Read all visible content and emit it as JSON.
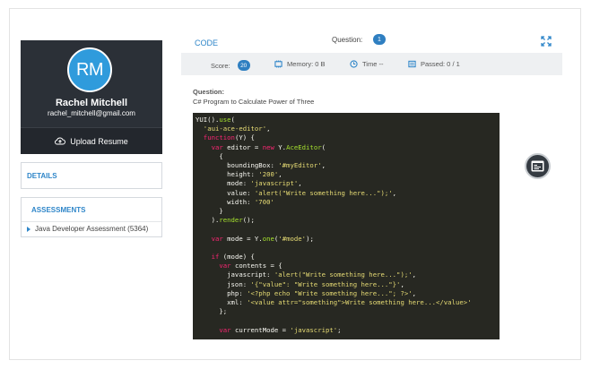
{
  "profile": {
    "initials": "RM",
    "name": "Rachel Mitchell",
    "email": "rachel_mitchell@gmail.com",
    "upload_label": "Upload Resume"
  },
  "nav": {
    "details_label": "DETAILS",
    "assessments_label": "ASSESSMENTS",
    "assessment_item": "Java Developer Assessment (5364)"
  },
  "header": {
    "code_label": "CODE",
    "question_label": "Question:",
    "question_number": "1"
  },
  "stats": {
    "score_label": "Score:",
    "score_value": "20",
    "memory": "Memory: 0 B",
    "time": "Time --",
    "passed": "Passed: 0 / 1"
  },
  "question": {
    "heading": "Question:",
    "text": "C# Program to Calculate Power of Three"
  },
  "editor": {
    "lines": [
      "YUI().use(",
      "  'aui-ace-editor',",
      "  function(Y) {",
      "    var editor = new Y.AceEditor(",
      "      {",
      "        boundingBox: '#myEditor',",
      "        height: '200',",
      "        mode: 'javascript',",
      "        value: 'alert(\"Write something here...\");',",
      "        width: '700'",
      "      }",
      "    ).render();",
      "",
      "    var mode = Y.one('#mode');",
      "",
      "    if (mode) {",
      "      var contents = {",
      "        javascript: 'alert(\"Write something here...\");',",
      "        json: '{\"value\": \"Write something here...\"}',",
      "        php: '<?php echo \"Write something here...\"; ?>',",
      "        xml: '<value attr=\"something\">Write something here...</value>'",
      "      };",
      "",
      "      var currentMode = 'javascript';"
    ]
  },
  "colors": {
    "accent": "#2f86c9",
    "badge": "#2f7fc1",
    "editor_bg": "#272822",
    "sidebar_bg": "#2b3037"
  }
}
